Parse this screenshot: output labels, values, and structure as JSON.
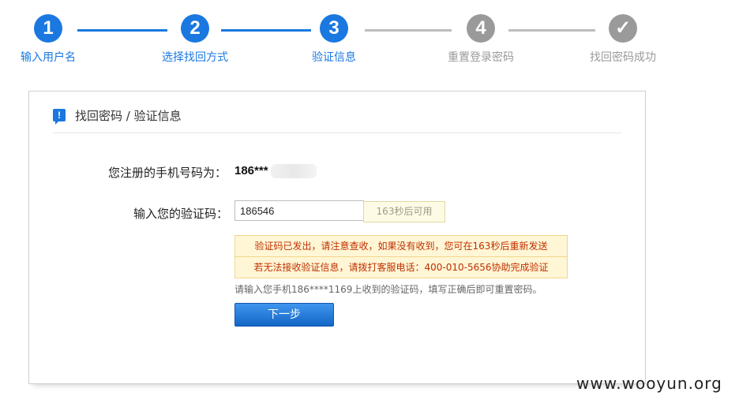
{
  "steps": [
    {
      "number": "1",
      "label": "输入用户名",
      "status": "done"
    },
    {
      "number": "2",
      "label": "选择找回方式",
      "status": "done"
    },
    {
      "number": "3",
      "label": "验证信息",
      "status": "done"
    },
    {
      "number": "4",
      "label": "重置登录密码",
      "status": "todo"
    },
    {
      "number": "✓",
      "label": "找回密码成功",
      "status": "todo"
    }
  ],
  "panel": {
    "title": "找回密码 / 验证信息",
    "phone_label": "您注册的手机号码为：",
    "phone_value": "186***",
    "code_label": "输入您的验证码：",
    "code_value": "186546",
    "resend_label": "163秒后可用",
    "notice_sent": "验证码已发出，请注意查收，如果没有收到，您可在163秒后重新发送",
    "notice_help": "若无法接收验证信息，请拨打客服电话：400-010-5656协助完成验证",
    "hint": "请输入您手机186****1169上收到的验证码，填写正确后即可重置密码。",
    "next_label": "下一步"
  },
  "watermark": "www.wooyun.org",
  "colors": {
    "accent": "#1a78e0",
    "inactive": "#9a9a9a",
    "notice_text": "#c03000",
    "notice_bg": "#fff6d6"
  }
}
